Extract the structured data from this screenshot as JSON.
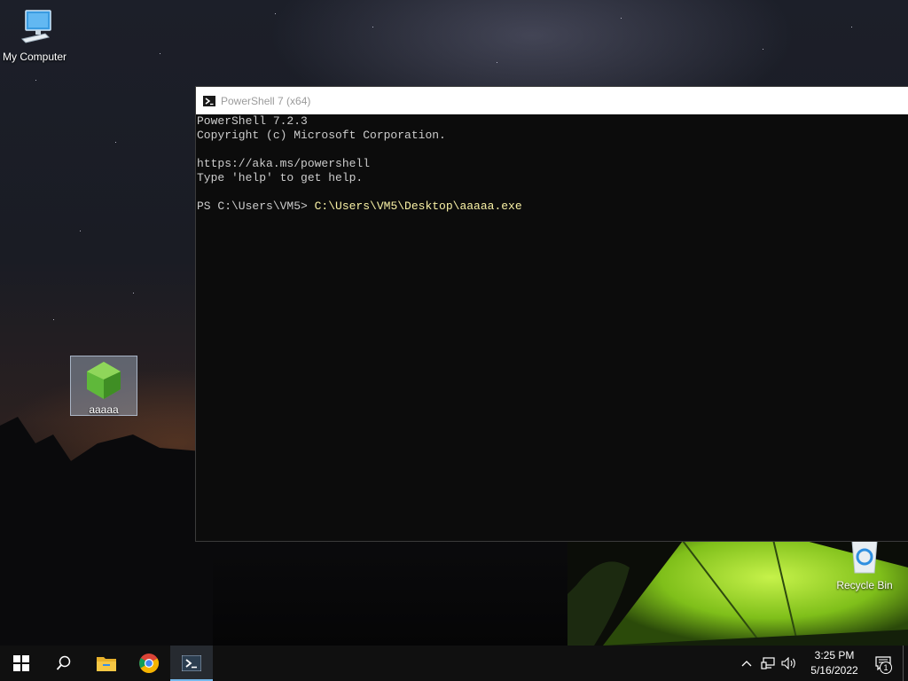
{
  "desktop": {
    "icons": [
      {
        "label": "My Computer",
        "icon": "computer-icon"
      },
      {
        "label": "aaaaa",
        "icon": "green-gem-icon"
      },
      {
        "label": "Recycle Bin",
        "icon": "recycle-bin-icon"
      }
    ]
  },
  "window": {
    "title": "PowerShell 7 (x64)",
    "icon": "powershell-icon",
    "console": {
      "lines": [
        "PowerShell 7.2.3",
        "Copyright (c) Microsoft Corporation.",
        "",
        "https://aka.ms/powershell",
        "Type 'help' to get help.",
        ""
      ],
      "prompt": "PS C:\\Users\\VM5> ",
      "command": "C:\\Users\\VM5\\Desktop\\aaaaa.exe"
    }
  },
  "taskbar": {
    "buttons": [
      {
        "icon": "windows-start-icon"
      },
      {
        "icon": "search-icon"
      },
      {
        "icon": "file-explorer-icon"
      },
      {
        "icon": "chrome-icon"
      },
      {
        "icon": "powershell-icon",
        "active": true
      }
    ],
    "tray": {
      "icons": [
        "chevron-up-icon",
        "network-icon",
        "volume-icon"
      ],
      "time": "3:25 PM",
      "date": "5/16/2022",
      "notification_count": "1"
    }
  },
  "colors": {
    "console_bg": "#0c0c0c",
    "console_text": "#cccccc",
    "command_text": "#f9f1a5",
    "taskbar_bg": "#101010",
    "accent": "#76b9ed"
  }
}
